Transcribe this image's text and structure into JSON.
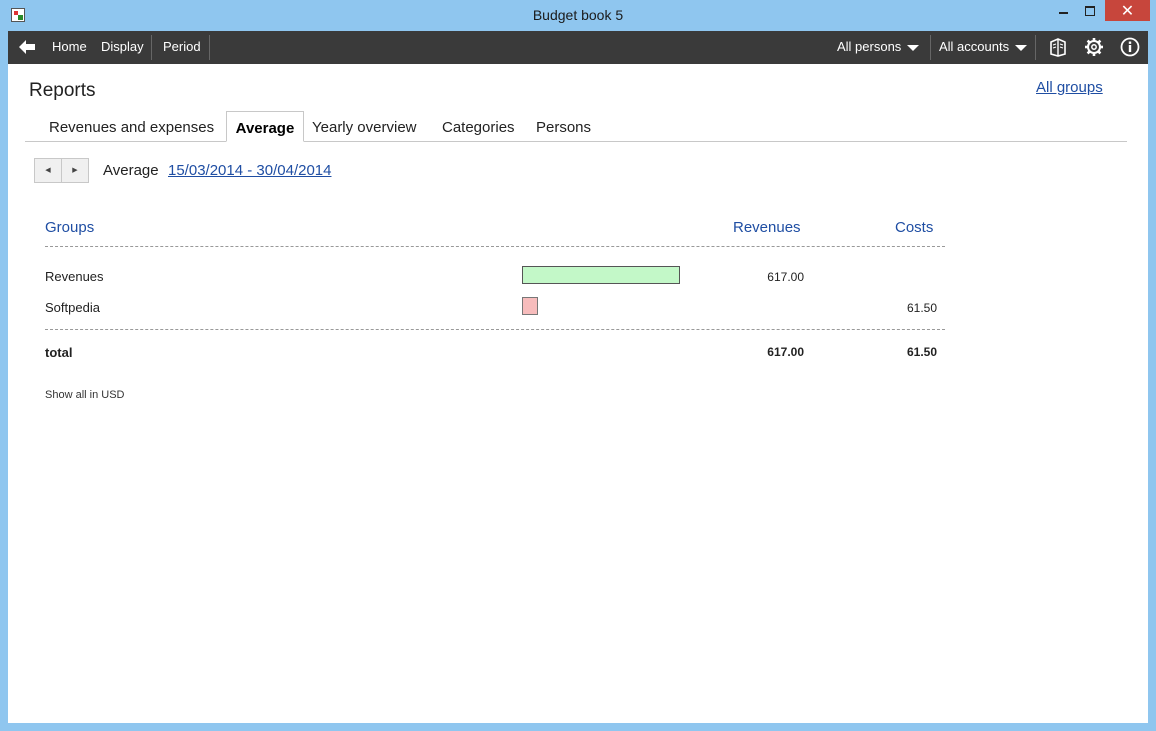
{
  "window": {
    "title": "Budget book 5"
  },
  "toolbar": {
    "home": "Home",
    "display": "Display",
    "period": "Period",
    "persons": "All persons",
    "accounts": "All accounts"
  },
  "page": {
    "heading": "Reports",
    "all_groups": "All groups"
  },
  "tabs": [
    {
      "label": "Revenues and expenses"
    },
    {
      "label": "Average"
    },
    {
      "label": "Yearly overview"
    },
    {
      "label": "Categories"
    },
    {
      "label": "Persons"
    }
  ],
  "period": {
    "label": "Average",
    "range": "15/03/2014 - 30/04/2014"
  },
  "table": {
    "headers": {
      "groups": "Groups",
      "revenues": "Revenues",
      "costs": "Costs"
    },
    "rows": [
      {
        "group": "Revenues",
        "revenues": "617.00",
        "costs": "",
        "revenue_value": 617.0,
        "cost_value": 0
      },
      {
        "group": "Softpedia",
        "revenues": "",
        "costs": "61.50",
        "revenue_value": 0,
        "cost_value": 61.5
      }
    ],
    "total": {
      "label": "total",
      "revenues": "617.00",
      "costs": "61.50"
    }
  },
  "show_all_usd": "Show all in USD",
  "colors": {
    "revenue_bar": "#c3f8c8",
    "cost_bar": "#f7bcbc",
    "link": "#1f4ea3",
    "toolbar": "#3a3a3a"
  }
}
